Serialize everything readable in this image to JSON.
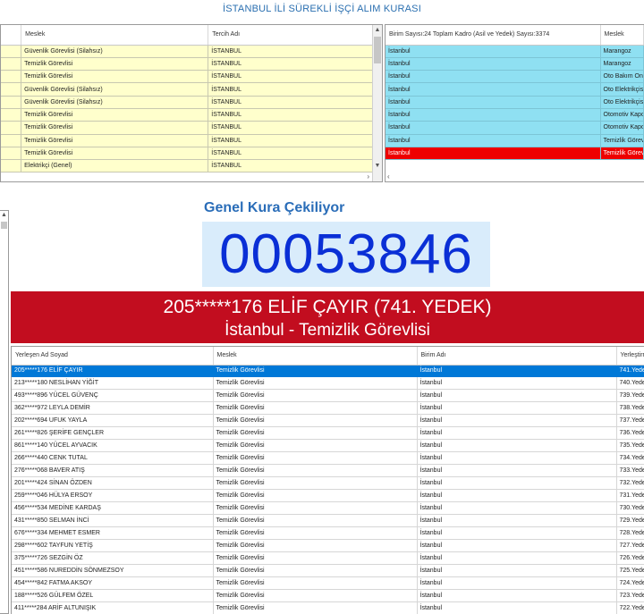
{
  "title": "İSTANBUL İLİ SÜREKLİ İŞÇİ ALIM KURASI",
  "left_grid": {
    "headers": [
      "Meslek",
      "Tercih Adı"
    ],
    "rows": [
      [
        "Güvenlik Görevlisi (Silahsız)",
        "İSTANBUL"
      ],
      [
        "Temizlik Görevlisi",
        "İSTANBUL"
      ],
      [
        "Temizlik Görevlisi",
        "İSTANBUL"
      ],
      [
        "Güvenlik Görevlisi (Silahsız)",
        "İSTANBUL"
      ],
      [
        "Güvenlik Görevlisi (Silahsız)",
        "İSTANBUL"
      ],
      [
        "Temizlik Görevlisi",
        "İSTANBUL"
      ],
      [
        "Temizlik Görevlisi",
        "İSTANBUL"
      ],
      [
        "Temizlik Görevlisi",
        "İSTANBUL"
      ],
      [
        "Temizlik Görevlisi",
        "İSTANBUL"
      ],
      [
        "Elektrikçi (Genel)",
        "İSTANBUL"
      ]
    ]
  },
  "right_grid": {
    "headers": [
      "Birim Sayısı:24 Toplam Kadro (Asil ve Yedek) Sayısı:3374",
      "Meslek"
    ],
    "rows": [
      [
        "İstanbul",
        "Marangoz"
      ],
      [
        "İstanbul",
        "Marangoz"
      ],
      [
        "İstanbul",
        "Oto Bakım Onarı"
      ],
      [
        "İstanbul",
        "Oto Elektrikçisi"
      ],
      [
        "İstanbul",
        "Oto Elektrikçisi"
      ],
      [
        "İstanbul",
        "Otomotiv Kapor"
      ],
      [
        "İstanbul",
        "Otomotiv Kapor"
      ],
      [
        "İstanbul",
        "Temizlik Görevl"
      ],
      [
        "İstanbul",
        "Temizlik Görevl"
      ]
    ],
    "highlight_color": "#ee0000"
  },
  "kura": {
    "label": "Genel Kura Çekiliyor",
    "number": "00053846"
  },
  "banner": {
    "line1": "205*****176 ELİF ÇAYIR (741. YEDEK)",
    "line2": "İstanbul - Temizlik Görevlisi",
    "color": "#c20d1f"
  },
  "bottom_grid": {
    "headers": [
      "Yerleşen Ad Soyad",
      "Meslek",
      "Birim Adı",
      "Yerleştirm"
    ],
    "rows": [
      [
        "205*****176 ELİF ÇAYIR",
        "Temizlik Görevlisi",
        "İstanbul",
        "741.Yedek"
      ],
      [
        "213*****180 NESLİHAN YİĞİT",
        "Temizlik Görevlisi",
        "İstanbul",
        "740.Yedek"
      ],
      [
        "493*****896 YÜCEL GÜVENÇ",
        "Temizlik Görevlisi",
        "İstanbul",
        "739.Yedek"
      ],
      [
        "362*****972 LEYLA DEMİR",
        "Temizlik Görevlisi",
        "İstanbul",
        "738.Yedek"
      ],
      [
        "202*****694 UFUK YAYLA",
        "Temizlik Görevlisi",
        "İstanbul",
        "737.Yedek"
      ],
      [
        "261*****826 ŞERİFE GENÇLER",
        "Temizlik Görevlisi",
        "İstanbul",
        "736.Yedek"
      ],
      [
        "861*****140 YÜCEL AYVACIK",
        "Temizlik Görevlisi",
        "İstanbul",
        "735.Yedek"
      ],
      [
        "266*****440 CENK TUTAL",
        "Temizlik Görevlisi",
        "İstanbul",
        "734.Yedek"
      ],
      [
        "276*****068 BAVER ATIŞ",
        "Temizlik Görevlisi",
        "İstanbul",
        "733.Yedek"
      ],
      [
        "201*****424 SİNAN ÖZDEN",
        "Temizlik Görevlisi",
        "İstanbul",
        "732.Yedek"
      ],
      [
        "259*****046 HÜLYA ERSOY",
        "Temizlik Görevlisi",
        "İstanbul",
        "731.Yedek"
      ],
      [
        "456*****534 MEDİNE KARDAŞ",
        "Temizlik Görevlisi",
        "İstanbul",
        "730.Yedek"
      ],
      [
        "431*****850 SELMAN İNCİ",
        "Temizlik Görevlisi",
        "İstanbul",
        "729.Yedek"
      ],
      [
        "676*****334 MEHMET ESMER",
        "Temizlik Görevlisi",
        "İstanbul",
        "728.Yedek"
      ],
      [
        "298*****602 TAYFUN YETİŞ",
        "Temizlik Görevlisi",
        "İstanbul",
        "727.Yedek"
      ],
      [
        "375*****726 SEZGİN ÖZ",
        "Temizlik Görevlisi",
        "İstanbul",
        "726.Yedek"
      ],
      [
        "451*****586 NUREDDİN SÖNMEZSOY",
        "Temizlik Görevlisi",
        "İstanbul",
        "725.Yedek"
      ],
      [
        "454*****842 FATMA AKSOY",
        "Temizlik Görevlisi",
        "İstanbul",
        "724.Yedek"
      ],
      [
        "188*****526 GÜLFEM ÖZEL",
        "Temizlik Görevlisi",
        "İstanbul",
        "723.Yedek"
      ],
      [
        "411*****284 ARİF ALTUNIŞIK",
        "Temizlik Görevlisi",
        "İstanbul",
        "722.Yedek"
      ]
    ],
    "selected_color": "#0078d7"
  }
}
